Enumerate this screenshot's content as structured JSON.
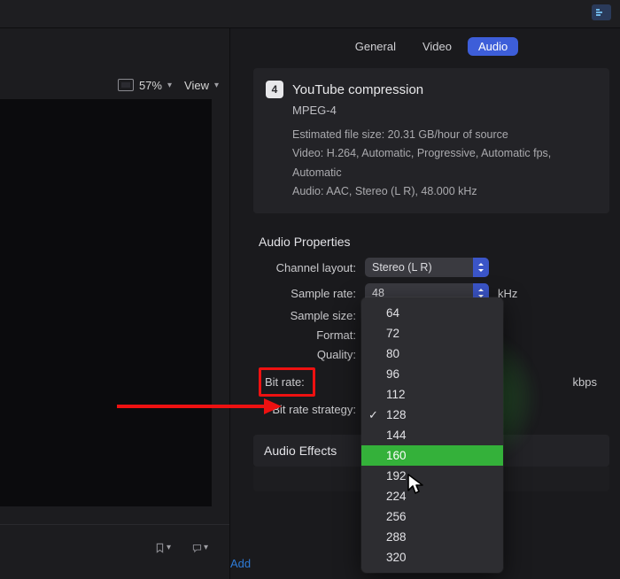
{
  "colors": {
    "accent": "#3d5ed9",
    "highlight_border": "#e11",
    "menu_highlight": "#34b13a"
  },
  "top": {
    "zoom_percent": "57%",
    "view_label": "View"
  },
  "tabs": {
    "items": [
      "General",
      "Video",
      "Audio"
    ],
    "active_index": 2
  },
  "summary": {
    "step": "4",
    "title": "YouTube compression",
    "container": "MPEG-4",
    "estimate": "Estimated file size: 20.31 GB/hour of source",
    "video_line": "Video: H.264, Automatic, Progressive, Automatic fps, Automatic",
    "audio_line": "Audio: AAC, Stereo (L R), 48.000 kHz"
  },
  "sections": {
    "audio_properties": "Audio Properties",
    "audio_effects": "Audio Effects"
  },
  "audio_props": {
    "channel_layout": {
      "label": "Channel layout:",
      "value": "Stereo (L R)"
    },
    "sample_rate": {
      "label": "Sample rate:",
      "value": "48",
      "unit": "kHz"
    },
    "sample_size": {
      "label": "Sample size:"
    },
    "format": {
      "label": "Format:"
    },
    "quality": {
      "label": "Quality:"
    },
    "bit_rate": {
      "label": "Bit rate:",
      "unit": "kbps"
    },
    "bit_rate_strategy": {
      "label": "Bit rate strategy:"
    }
  },
  "bitrate_menu": {
    "options": [
      "64",
      "72",
      "80",
      "96",
      "112",
      "128",
      "144",
      "160",
      "192",
      "224",
      "256",
      "288",
      "320"
    ],
    "checked": "128",
    "highlighted": "160"
  },
  "footer": {
    "add_label": "Add"
  }
}
